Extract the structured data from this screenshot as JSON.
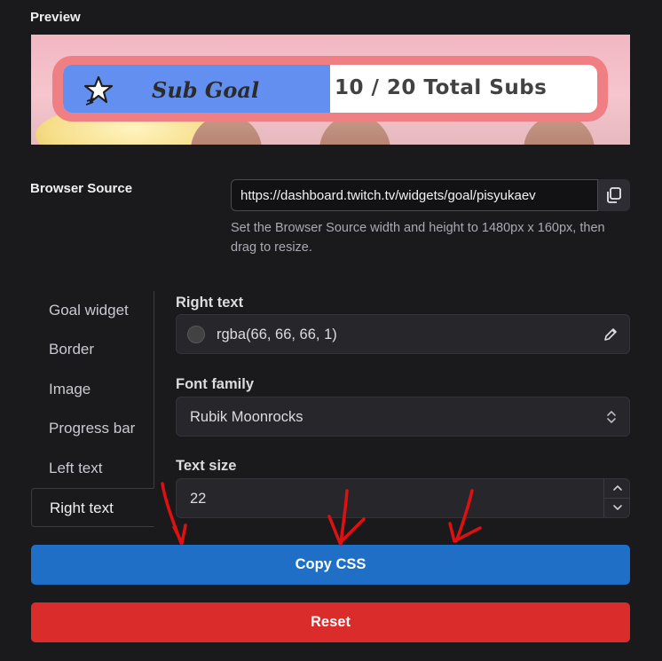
{
  "preview": {
    "title": "Preview",
    "goal": {
      "left_text": "Sub Goal",
      "right_text": "10 / 20 Total Subs",
      "progress_fraction": 0.5,
      "icon": "star-icon"
    }
  },
  "browser_source": {
    "label": "Browser Source",
    "url": "https://dashboard.twitch.tv/widgets/goal/pisyukaev",
    "help": "Set the Browser Source width and height to 1480px x 160px, then drag to resize."
  },
  "tabs": [
    {
      "label": "Goal widget",
      "active": false
    },
    {
      "label": "Border",
      "active": false
    },
    {
      "label": "Image",
      "active": false
    },
    {
      "label": "Progress bar",
      "active": false
    },
    {
      "label": "Left text",
      "active": false
    },
    {
      "label": "Right text",
      "active": true
    }
  ],
  "form": {
    "right_text": {
      "label": "Right text",
      "value": "rgba(66, 66, 66, 1)"
    },
    "font_family": {
      "label": "Font family",
      "value": "Rubik Moonrocks"
    },
    "text_size": {
      "label": "Text size",
      "value": "22"
    }
  },
  "buttons": {
    "copy_css": "Copy CSS",
    "reset": "Reset"
  },
  "colors": {
    "background": "#1a1a1d",
    "copy_button": "#1f6fc6",
    "reset_button": "#db2c2c",
    "goal_frame": "#f07f83",
    "goal_progress": "#6390f0",
    "annotation_arrows": "#e01010"
  }
}
